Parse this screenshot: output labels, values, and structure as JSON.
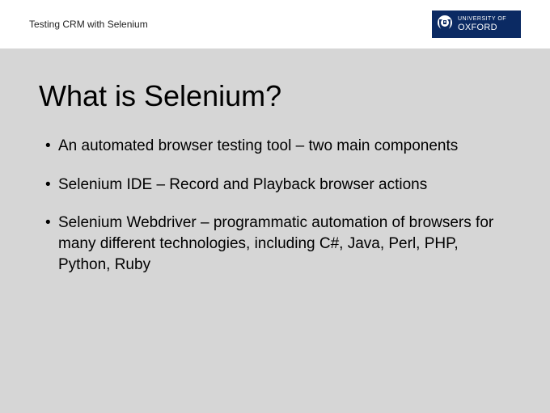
{
  "header": {
    "breadcrumb": "Testing CRM with Selenium",
    "badge": {
      "line1": "UNIVERSITY OF",
      "line2": "OXFORD"
    }
  },
  "slide": {
    "title": "What is Selenium?",
    "bullets": [
      "An automated browser testing tool – two main components",
      "Selenium IDE – Record and Playback browser actions",
      "Selenium Webdriver – programmatic automation of browsers for many different technologies, including C#, Java, Perl, PHP, Python, Ruby"
    ]
  }
}
